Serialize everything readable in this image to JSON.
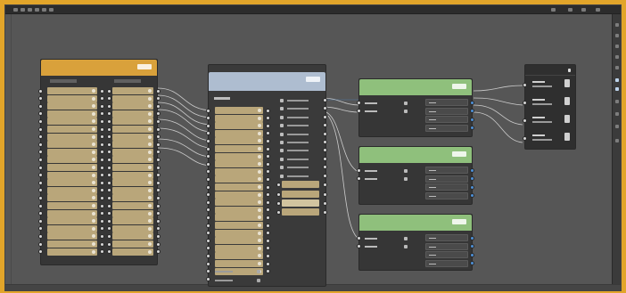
{
  "colors": {
    "frame_outer": "#e2a52a",
    "canvas": "#565656",
    "node_body": "#363636",
    "header_orange": "#d9a13b",
    "header_blue": "#aebdd0",
    "header_green": "#8fc07c",
    "field_tan": "#b9a67a",
    "socket_blue": "#4d8fd6",
    "wire_light": "#d9d9d9"
  },
  "icons": {
    "topbar": [
      "menu-icon",
      "undo-icon",
      "redo-icon",
      "zoom-icon",
      "grid-icon",
      "settings-icon"
    ],
    "window": [
      "minimize-icon",
      "maximize-icon",
      "close-icon"
    ]
  },
  "nodes": {
    "orange": {
      "header_color": "#d9a13b",
      "title": "",
      "subtitle": ""
    },
    "blue": {
      "header_color": "#aebdd0",
      "title": "",
      "subtitle": ""
    },
    "green1": {
      "header_color": "#8fc07c",
      "title": "",
      "subtitle": ""
    },
    "green2": {
      "header_color": "#8fc07c",
      "title": "",
      "subtitle": ""
    },
    "green3": {
      "header_color": "#8fc07c",
      "title": "",
      "subtitle": ""
    },
    "output": {
      "title": ""
    }
  }
}
